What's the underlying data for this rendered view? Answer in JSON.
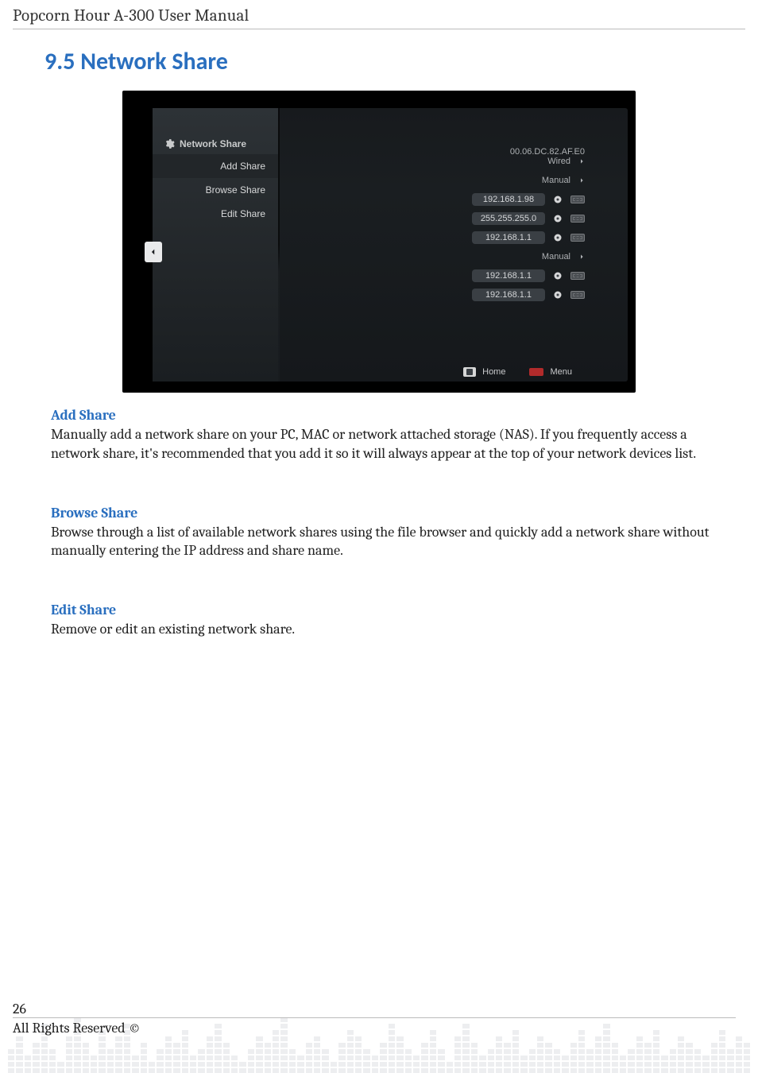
{
  "doc_header": "Popcorn Hour A-300 User Manual",
  "section_heading": "9.5 Network Share",
  "screenshot": {
    "sidebar_title": "Network Share",
    "sidebar_items": [
      "Add Share",
      "Browse Share",
      "Edit Share"
    ],
    "selected_index": 0,
    "mac": "00.06.DC.82.AF.E0",
    "rows": [
      {
        "type": "link",
        "label": "Wired"
      },
      {
        "type": "link",
        "label": "Manual"
      },
      {
        "type": "field",
        "value": "192.168.1.98"
      },
      {
        "type": "field",
        "value": "255.255.255.0"
      },
      {
        "type": "field",
        "value": "192.168.1.1"
      },
      {
        "type": "link",
        "label": "Manual"
      },
      {
        "type": "field",
        "value": "192.168.1.1"
      },
      {
        "type": "field",
        "value": "192.168.1.1"
      }
    ],
    "footer": {
      "home": "Home",
      "menu": "Menu"
    }
  },
  "body": {
    "add_share_h": "Add Share",
    "add_share_p": "Manually add a network share on your PC, MAC or network attached storage (NAS). If you frequently access a network share, it's recommended that you add it so it will always appear at the top of your network devices list.",
    "browse_share_h": "Browse Share",
    "browse_share_p": "Browse through a list of available network shares using the file browser and quickly add a network share without manually entering the IP address and share name.",
    "edit_share_h": "Edit Share",
    "edit_share_p": "Remove or edit an existing network share."
  },
  "page_number": "26",
  "rights": "All Rights Reserved ©",
  "eq_heights": [
    4,
    6,
    3,
    5,
    8,
    4,
    2,
    6,
    9,
    5,
    3,
    7,
    4,
    6,
    8,
    3,
    5,
    2,
    4,
    6,
    5,
    7,
    3,
    4,
    6,
    8,
    5,
    3,
    2,
    4,
    6,
    5,
    7,
    9,
    4,
    3,
    5,
    6,
    4,
    2,
    5,
    7,
    6,
    4,
    3,
    5,
    8,
    6,
    4,
    3,
    5,
    7,
    4,
    2,
    6,
    8,
    5,
    3,
    4,
    6,
    5,
    7,
    3,
    4,
    6,
    5,
    4,
    3,
    5,
    7,
    4,
    6,
    8,
    5,
    3,
    4,
    6,
    5,
    7,
    3,
    4,
    6,
    5,
    4,
    3,
    5,
    7,
    4,
    6,
    5
  ]
}
